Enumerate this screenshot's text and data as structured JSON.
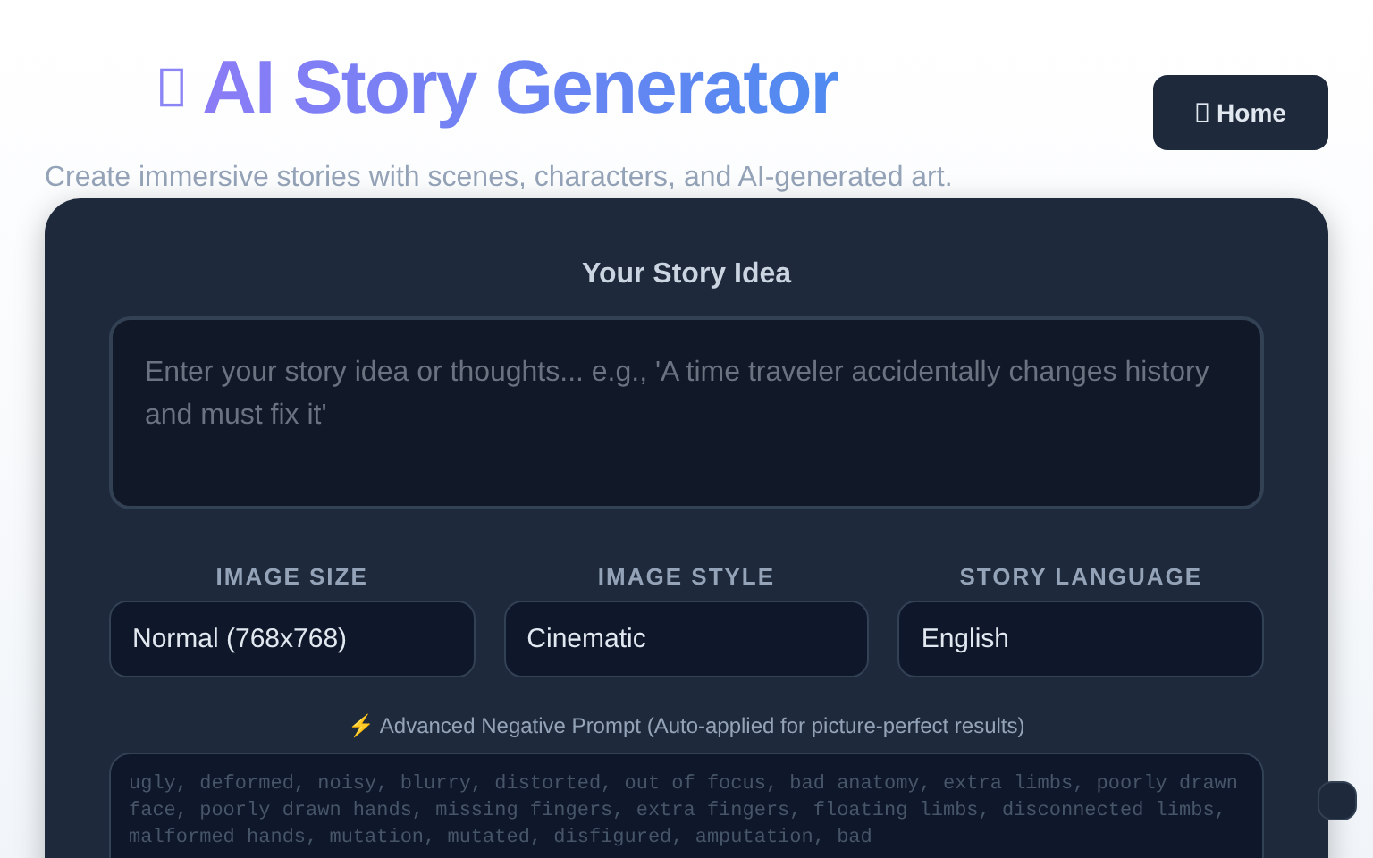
{
  "header": {
    "title": "AI Story Generator",
    "subtitle": "Create immersive stories with scenes, characters, and AI-generated art.",
    "home_button": "Home"
  },
  "story_idea": {
    "label": "Your Story Idea",
    "placeholder": "Enter your story idea or thoughts... e.g., 'A time traveler accidentally changes history and must fix it'"
  },
  "options": [
    {
      "label": "IMAGE SIZE",
      "value": "Normal (768x768)"
    },
    {
      "label": "IMAGE STYLE",
      "value": "Cinematic"
    },
    {
      "label": "STORY LANGUAGE",
      "value": "English"
    }
  ],
  "negative_prompt": {
    "label": "⚡ Advanced Negative Prompt (Auto-applied for picture-perfect results)",
    "value": "ugly, deformed, noisy, blurry, distorted, out of focus, bad anatomy, extra limbs, poorly drawn face, poorly drawn hands, missing fingers, extra fingers, floating limbs, disconnected limbs, malformed hands, mutation, mutated, disfigured, amputation, bad"
  }
}
